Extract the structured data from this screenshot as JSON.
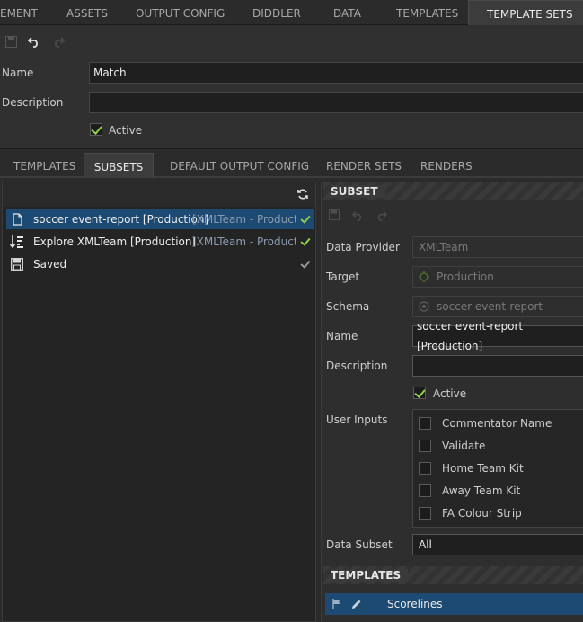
{
  "top_tabs": [
    "EMENT",
    "ASSETS",
    "OUTPUT CONFIG",
    "DIDDLER",
    "DATA",
    "TEMPLATES",
    "TEMPLATE SETS"
  ],
  "form": {
    "name_label": "Name",
    "name_value": "Match",
    "description_label": "Description",
    "description_value": "",
    "active_label": "Active"
  },
  "sub_tabs": [
    "TEMPLATES",
    "SUBSETS",
    "DEFAULT OUTPUT CONFIG",
    "RENDER SETS",
    "RENDERS"
  ],
  "subsets": [
    {
      "title": "soccer event-report [Production]",
      "source": "[XMLTeam - Product"
    },
    {
      "title": "Explore XMLTeam [Production]",
      "source": "[XMLTeam - Productio"
    },
    {
      "title": "Saved",
      "source": ""
    }
  ],
  "subset_panel": {
    "header": "SUBSET",
    "data_provider_label": "Data Provider",
    "data_provider_value": "XMLTeam",
    "target_label": "Target",
    "target_value": "Production",
    "schema_label": "Schema",
    "schema_value": "soccer event-report",
    "name_label": "Name",
    "name_value": "soccer event-report [Production]",
    "description_label": "Description",
    "description_value": "",
    "active_label": "Active",
    "user_inputs_label": "User Inputs",
    "user_inputs": [
      "Commentator Name",
      "Validate",
      "Home Team Kit",
      "Away Team Kit",
      "FA Colour Strip"
    ],
    "data_subset_label": "Data Subset",
    "data_subset_value": "All"
  },
  "templates_panel": {
    "header": "TEMPLATES",
    "rows": [
      "Scorelines"
    ]
  },
  "colors": {
    "accent_selected": "#1d4a73",
    "check_green": "#8fd14f"
  }
}
